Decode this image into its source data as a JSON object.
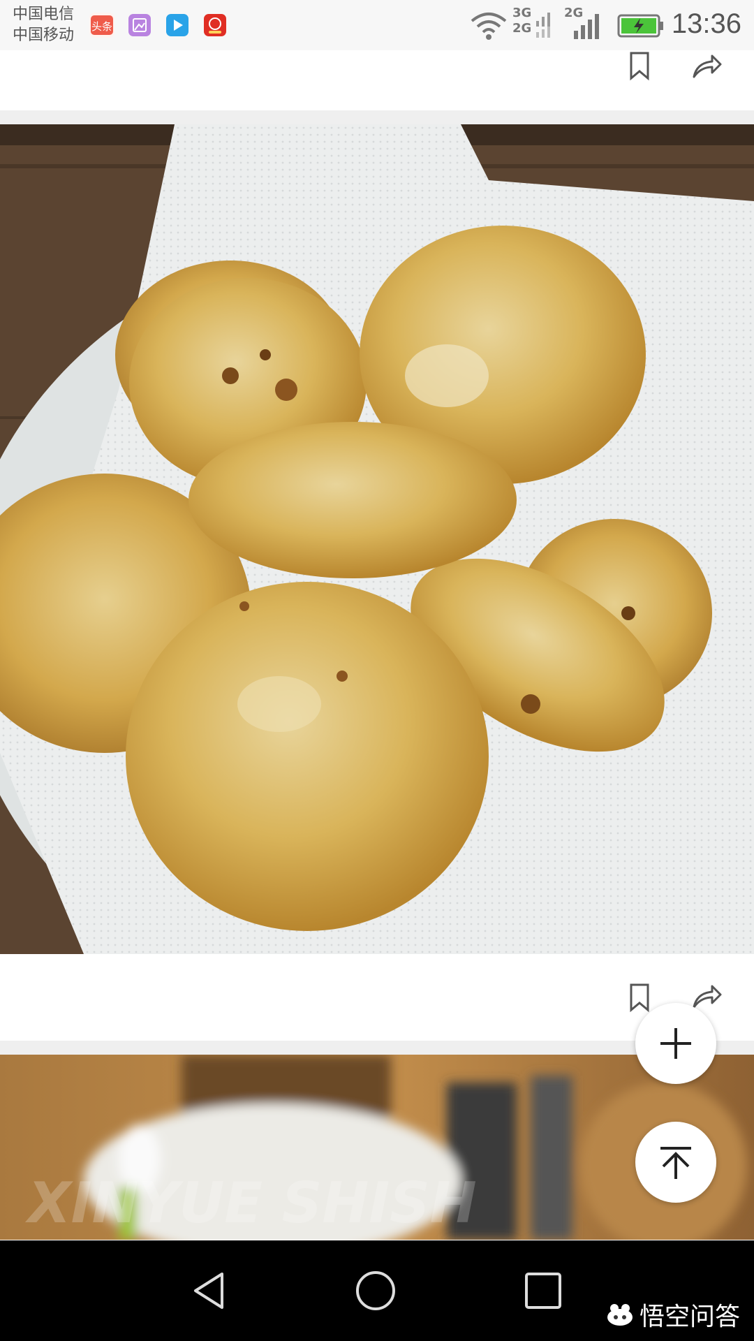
{
  "status_bar": {
    "carrier_1": "中国电信",
    "carrier_2": "中国移动",
    "app_icons": [
      "toutiao-app-icon",
      "gallery-app-icon",
      "video-app-icon",
      "pinduoduo-app-icon"
    ],
    "toutiao_label": "头条",
    "network_label_1": "3G",
    "network_label_2": "2G",
    "network_label_3": "2G",
    "battery": "charging",
    "time": "13:36"
  },
  "feed": {
    "card_1": {
      "actions": [
        "bookmark-icon",
        "share-icon"
      ]
    },
    "card_2": {
      "image": "fried lotus root cakes on paper towel",
      "actions": [
        "bookmark-icon",
        "share-icon"
      ]
    },
    "card_3": {
      "image_watermark": "XINYUE SHISH"
    }
  },
  "floating": {
    "add": "plus-icon",
    "top": "back-to-top-icon"
  },
  "nav_bar": {
    "back": "back-triangle-icon",
    "home": "home-circle-icon",
    "recent": "recent-square-icon"
  },
  "brand_watermark": "悟空问答",
  "colors": {
    "status_bar_bg": "#f7f7f7",
    "divider": "#efefef",
    "nav_bar_bg": "#000000"
  }
}
